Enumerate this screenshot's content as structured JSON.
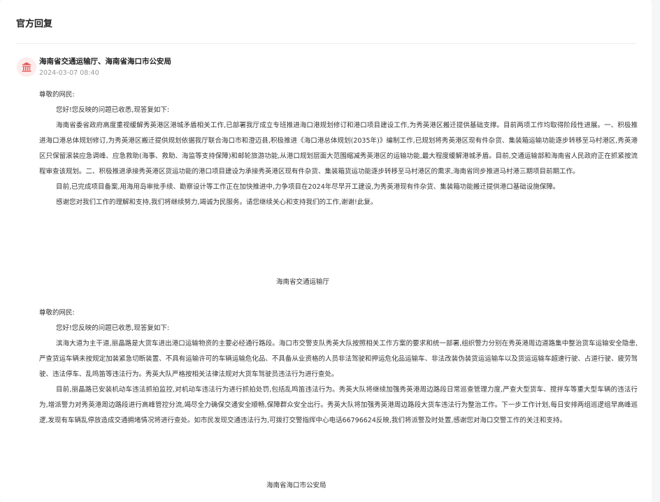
{
  "section": {
    "title": "官方回复"
  },
  "reply": {
    "author": "海南省交通运输厅、海南省海口市公安局",
    "timestamp": "2024-03-07 08:40",
    "icon": "government-building-icon",
    "icon_color": "#e25b5b",
    "icon_bg": "#fdecec"
  },
  "block1": {
    "salutation": "尊敬的网民:",
    "greeting": "您好!您反映的问题已收悉,现答复如下:",
    "para1": "海南省委省政府高度重视缓解秀英港区港城矛盾相关工作,已部署我厅成立专班推进海口港规划修订和港口项目建设工作,为秀英港区搬迁提供基础支撑。目前两项工作均取得阶段性进展。一、积极推进海口港总体规划修订,为秀英港区搬迁提供规划依据我厅联合海口市和澄迈县,积极推进《海口港总体规划(2035年)》编制工作,已规划将秀英港区现有件杂货、集装箱运输功能逐步转移至马村港区,秀英港区只保留滚装应急调峰、应急救助(海事、救助、海监等支持保障)和邮轮旅游功能,从港口规划层面大范围缩减秀英港区的运输功能,最大程度缓解港城矛盾。目前,交通运输部和海南省人民政府正在抓紧按流程审查该规划。二、积极推进承接秀英港区货运功能的港口项目建设为承接秀英港区现有件杂货、集装箱货运功能逐步转移至马村港区的需求,海南省同步推进马村港三期项目前期工作。",
    "para2": "目前,已完成项目备案,用海用岛审批手续、勘察设计等工作正在加快推进中,力争项目在2024年尽早开工建设,为秀英港现有件杂货、集装箱功能搬迁提供港口基础设施保障。",
    "closing": "感谢您对我们工作的理解和支持,我们将继续努力,竭诚为民服务。请您继续关心和支持我们的工作,谢谢!此复。",
    "signature": "海南省交通运输厅"
  },
  "block2": {
    "salutation": "尊敬的网民:",
    "greeting": "您好!您反映的问题已收悉,现答复如下:",
    "para1": "滨海大道为主干道,丽晶路是大货车进出港口运输物资的主要必经通行路段。海口市交警支队秀英大队按照相关工作方案的要求和统一部署,组织警力分别在秀英港周边道路集中整治货车运输安全隐患,严查货运车辆未按规定加装紧急切断装置、不具有运输许可的车辆运输危化品、不具备从业资格的人员非法驾驶和押运危化品运输车、非法改装伪装货运运输车以及货运运输车超速行驶、占道行驶、疲劳驾驶、违法停车、乱鸣笛等违法行为。秀英大队严格按相关法律法规对大货车驾驶员违法行为进行查处。",
    "para2": "目前,丽晶路已安装机动车违法抓拍监控,对机动车违法行为进行抓拍处罚,包括乱鸣笛违法行为。秀英大队将继续加强秀英港周边路段日常巡查管理力度,严查大型货车、搅拌车等重大型车辆的违法行为,增派警力对秀英港周边路段进行高峰管控分流,竭尽全力确保交通安全顺畅,保障群众安全出行。秀英大队将加强秀英港周边路段大货车违法行为整治工作。下一步工作计划,每日安排两组巡逻组早高峰巡逻,发现有车辆乱停放造成交通拥堵情况将进行查处。如市民发现交通违法行为,可拨打交警指挥中心电话66796624反映,我们将派警及时处置,感谢您对海口交警工作的关注和支持。",
    "signature": "海南省海口市公安局"
  }
}
